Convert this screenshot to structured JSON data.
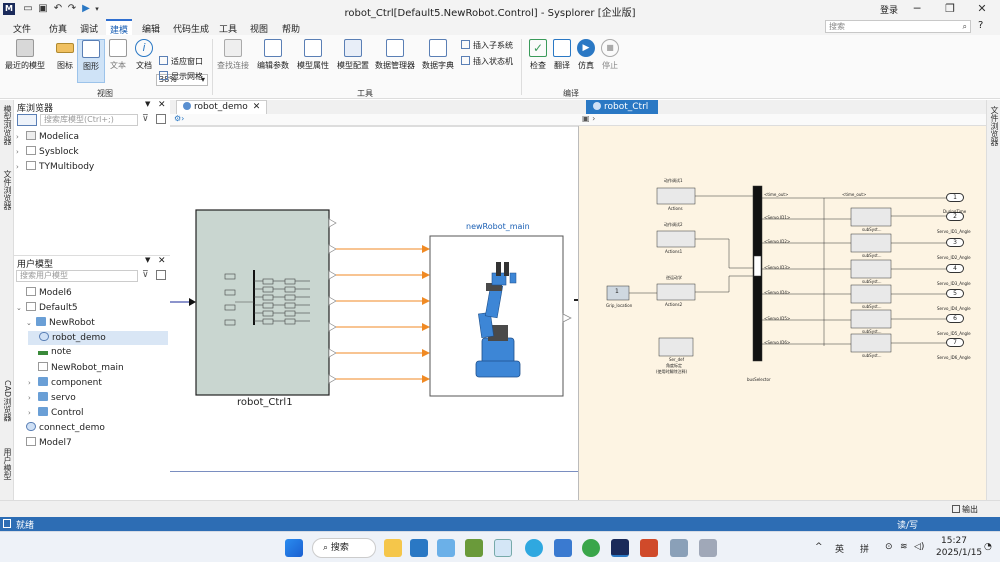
{
  "title_bar": {
    "logo": "M",
    "title": "robot_Ctrl[Default5.NewRobot.Control] - Sysplorer [企业版]",
    "login": "登录"
  },
  "menu": {
    "items": [
      "文件",
      "仿真",
      "调试",
      "建模",
      "编辑",
      "代码生成",
      "工具",
      "视图",
      "帮助"
    ],
    "active": "建模",
    "search_placeholder": "搜索"
  },
  "ribbon": {
    "recent_label": "最近的模型",
    "icon_label": "图标",
    "diagram_label": "图形",
    "text_label": "文本",
    "doc_label": "文档",
    "zoom": "38%",
    "fit_window": "适应窗口",
    "show_grid": "显示网格",
    "find_conn": "查找连接",
    "edit_params": "编辑参数",
    "model_props": "模型属性",
    "model_config": "模型配置",
    "data_manager": "数据管理器",
    "data_dict": "数据字典",
    "insert_subsystem": "插入子系统",
    "insert_statemachine": "插入状态机",
    "check": "检查",
    "translate": "翻译",
    "simulate": "仿真",
    "stop": "停止",
    "group_view": "视图",
    "group_tools": "工具",
    "group_compile": "编译"
  },
  "left_strip": {
    "lib_browser": "模型浏览器",
    "file_browser": "文件浏览器",
    "cad_browser": "CAD浏览器",
    "user_browser": "用户模型"
  },
  "right_strip": {
    "file_browser": "文件浏览器"
  },
  "library": {
    "title": "库浏览器",
    "search_placeholder": "搜索库模型(Ctrl+;)",
    "items": [
      "Modelica",
      "Sysblock",
      "TYMultibody"
    ]
  },
  "user_model": {
    "title": "用户模型",
    "search_placeholder": "搜索用户模型",
    "items": [
      "Model6",
      "Default5",
      "NewRobot",
      "robot_demo",
      "note",
      "NewRobot_main",
      "component",
      "servo",
      "Control",
      "connect_demo",
      "Model7"
    ]
  },
  "doc1": {
    "tab": "robot_demo",
    "block1_label": "robot_Ctrl1",
    "block2_label": "newRobot_main"
  },
  "doc2": {
    "tab": "robot_Ctrl",
    "labels": {
      "act1": "动作调试1",
      "act1_sub": "Actions",
      "act2": "动作调试2",
      "act2_sub": "Actions1",
      "act3": "逆运动学",
      "act3_sub": "Actions2",
      "grip": "Grip_location",
      "grip_val": "1",
      "ser": "Ser_def",
      "ser2": "角度标定",
      "ser3": "(使用时解除注释)",
      "bus": "busSelector",
      "outputs": [
        "DuringTime",
        "Servo_ID1_Angle",
        "Servo_ID2_Angle",
        "Servo_ID3_Angle",
        "Servo_ID4_Angle",
        "Servo_ID5_Angle",
        "Servo_ID6_Angle"
      ],
      "out_nums": [
        "1",
        "2",
        "3",
        "4",
        "5",
        "6",
        "7"
      ],
      "sub": [
        "subSyst...",
        "subSyst...",
        "subSyst...",
        "subSyst...",
        "subSyst...",
        "subSyst..."
      ],
      "sig_time": "<time_out>",
      "sigs": [
        "<Servo ID1>",
        "<Servo ID2>",
        "<Servo ID3>",
        "<Servo ID4>",
        "<Servo ID5>",
        "<Servo ID6>"
      ]
    }
  },
  "output_bar": {
    "label": "输出"
  },
  "status": {
    "left": "就绪",
    "right": "读/写"
  },
  "taskbar": {
    "search": "搜索",
    "lang1": "英",
    "lang2": "拼",
    "time": "15:27",
    "date": "2025/1/15"
  },
  "colors": {
    "accent": "#2a78c4",
    "block_grey": "#c9d6d0",
    "canvas2_bg": "#fdf4e3",
    "orange": "#f08a24",
    "robot_blue": "#3d86d6"
  }
}
